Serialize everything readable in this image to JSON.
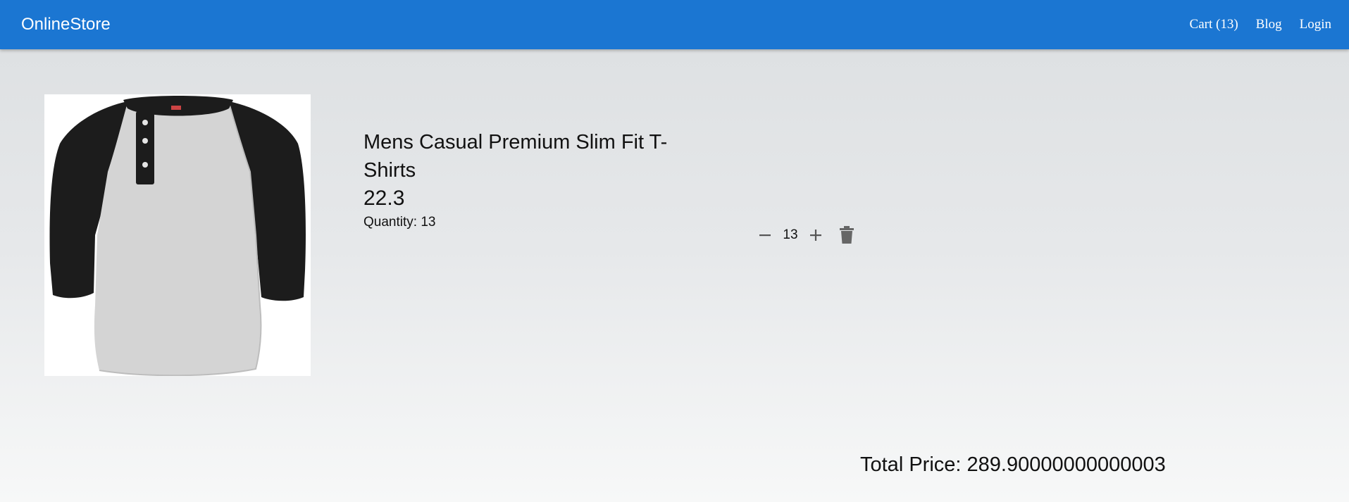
{
  "navbar": {
    "brand": "OnlineStore",
    "links": [
      "Cart (13)",
      "Blog",
      "Login"
    ]
  },
  "cart": {
    "items": [
      {
        "title": "Mens Casual Premium Slim Fit T-Shirts",
        "price": "22.3",
        "quantity_label": "Quantity: 13",
        "quantity": "13",
        "image": "henley-tshirt-grey-black-sleeves"
      }
    ],
    "total_label": "Total Price: 289.90000000000003"
  },
  "icons": {
    "decrement": "minus-icon",
    "increment": "plus-icon",
    "delete": "trash-icon"
  },
  "colors": {
    "navbar": "#1b76d2",
    "icon": "#555555"
  }
}
